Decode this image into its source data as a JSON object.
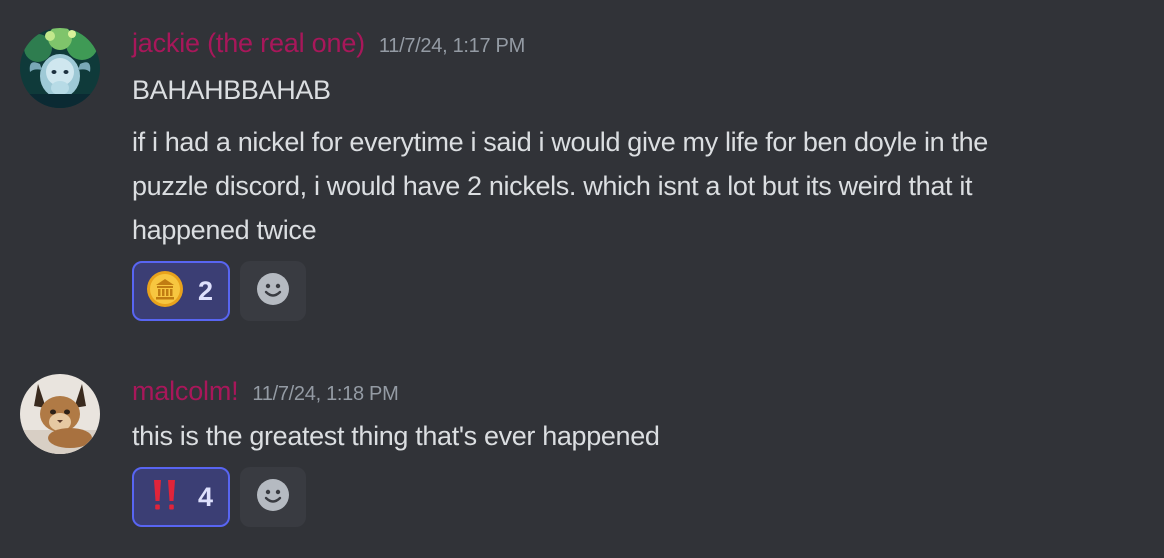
{
  "messages": [
    {
      "username": "jackie (the real one)",
      "timestamp": "11/7/24, 1:17 PM",
      "lines": [
        "BAHAHBBAHAB",
        "if i had a nickel for everytime i said i would give my life for ben doyle in the",
        "puzzle discord, i would have 2 nickels. which isnt a lot but its weird that it",
        "happened twice"
      ],
      "reaction": {
        "emoji": "coin-emoji",
        "count": "2"
      },
      "add_reaction_icon": "smiley-icon"
    },
    {
      "username": "malcolm!",
      "timestamp": "11/7/24, 1:18 PM",
      "lines": [
        "this is the greatest thing that's ever happened"
      ],
      "reaction": {
        "emoji": "double-exclamation-emoji",
        "count": "4"
      },
      "add_reaction_icon": "smiley-icon"
    }
  ],
  "colors": {
    "background": "#313338",
    "username": "#a8175a",
    "timestamp": "#949ba4",
    "text": "#dbdee1",
    "reaction_bg": "#3b3e74",
    "reaction_border": "#5865f2"
  }
}
